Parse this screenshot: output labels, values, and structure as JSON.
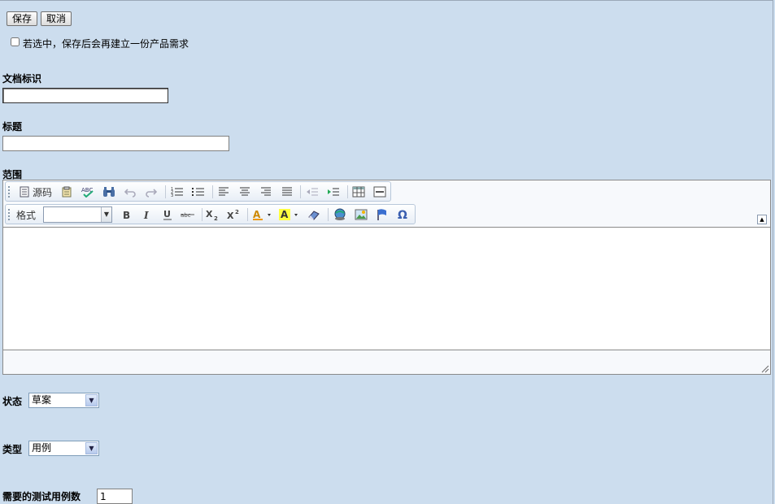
{
  "actions": {
    "save_label": "保存",
    "cancel_label": "取消"
  },
  "recreate_option": {
    "label": "若选中，保存后会再建立一份产品需求",
    "checked": false
  },
  "doc_id": {
    "label": "文档标识",
    "value": ""
  },
  "title": {
    "label": "标题",
    "value": ""
  },
  "scope": {
    "label": "范围",
    "toolbar": {
      "source_label": "源码",
      "format_label": "格式",
      "format_value": ""
    }
  },
  "status": {
    "label": "状态",
    "value": "草案"
  },
  "type": {
    "label": "类型",
    "value": "用例"
  },
  "test_case_count": {
    "label": "需要的测试用例数",
    "value": "1"
  }
}
